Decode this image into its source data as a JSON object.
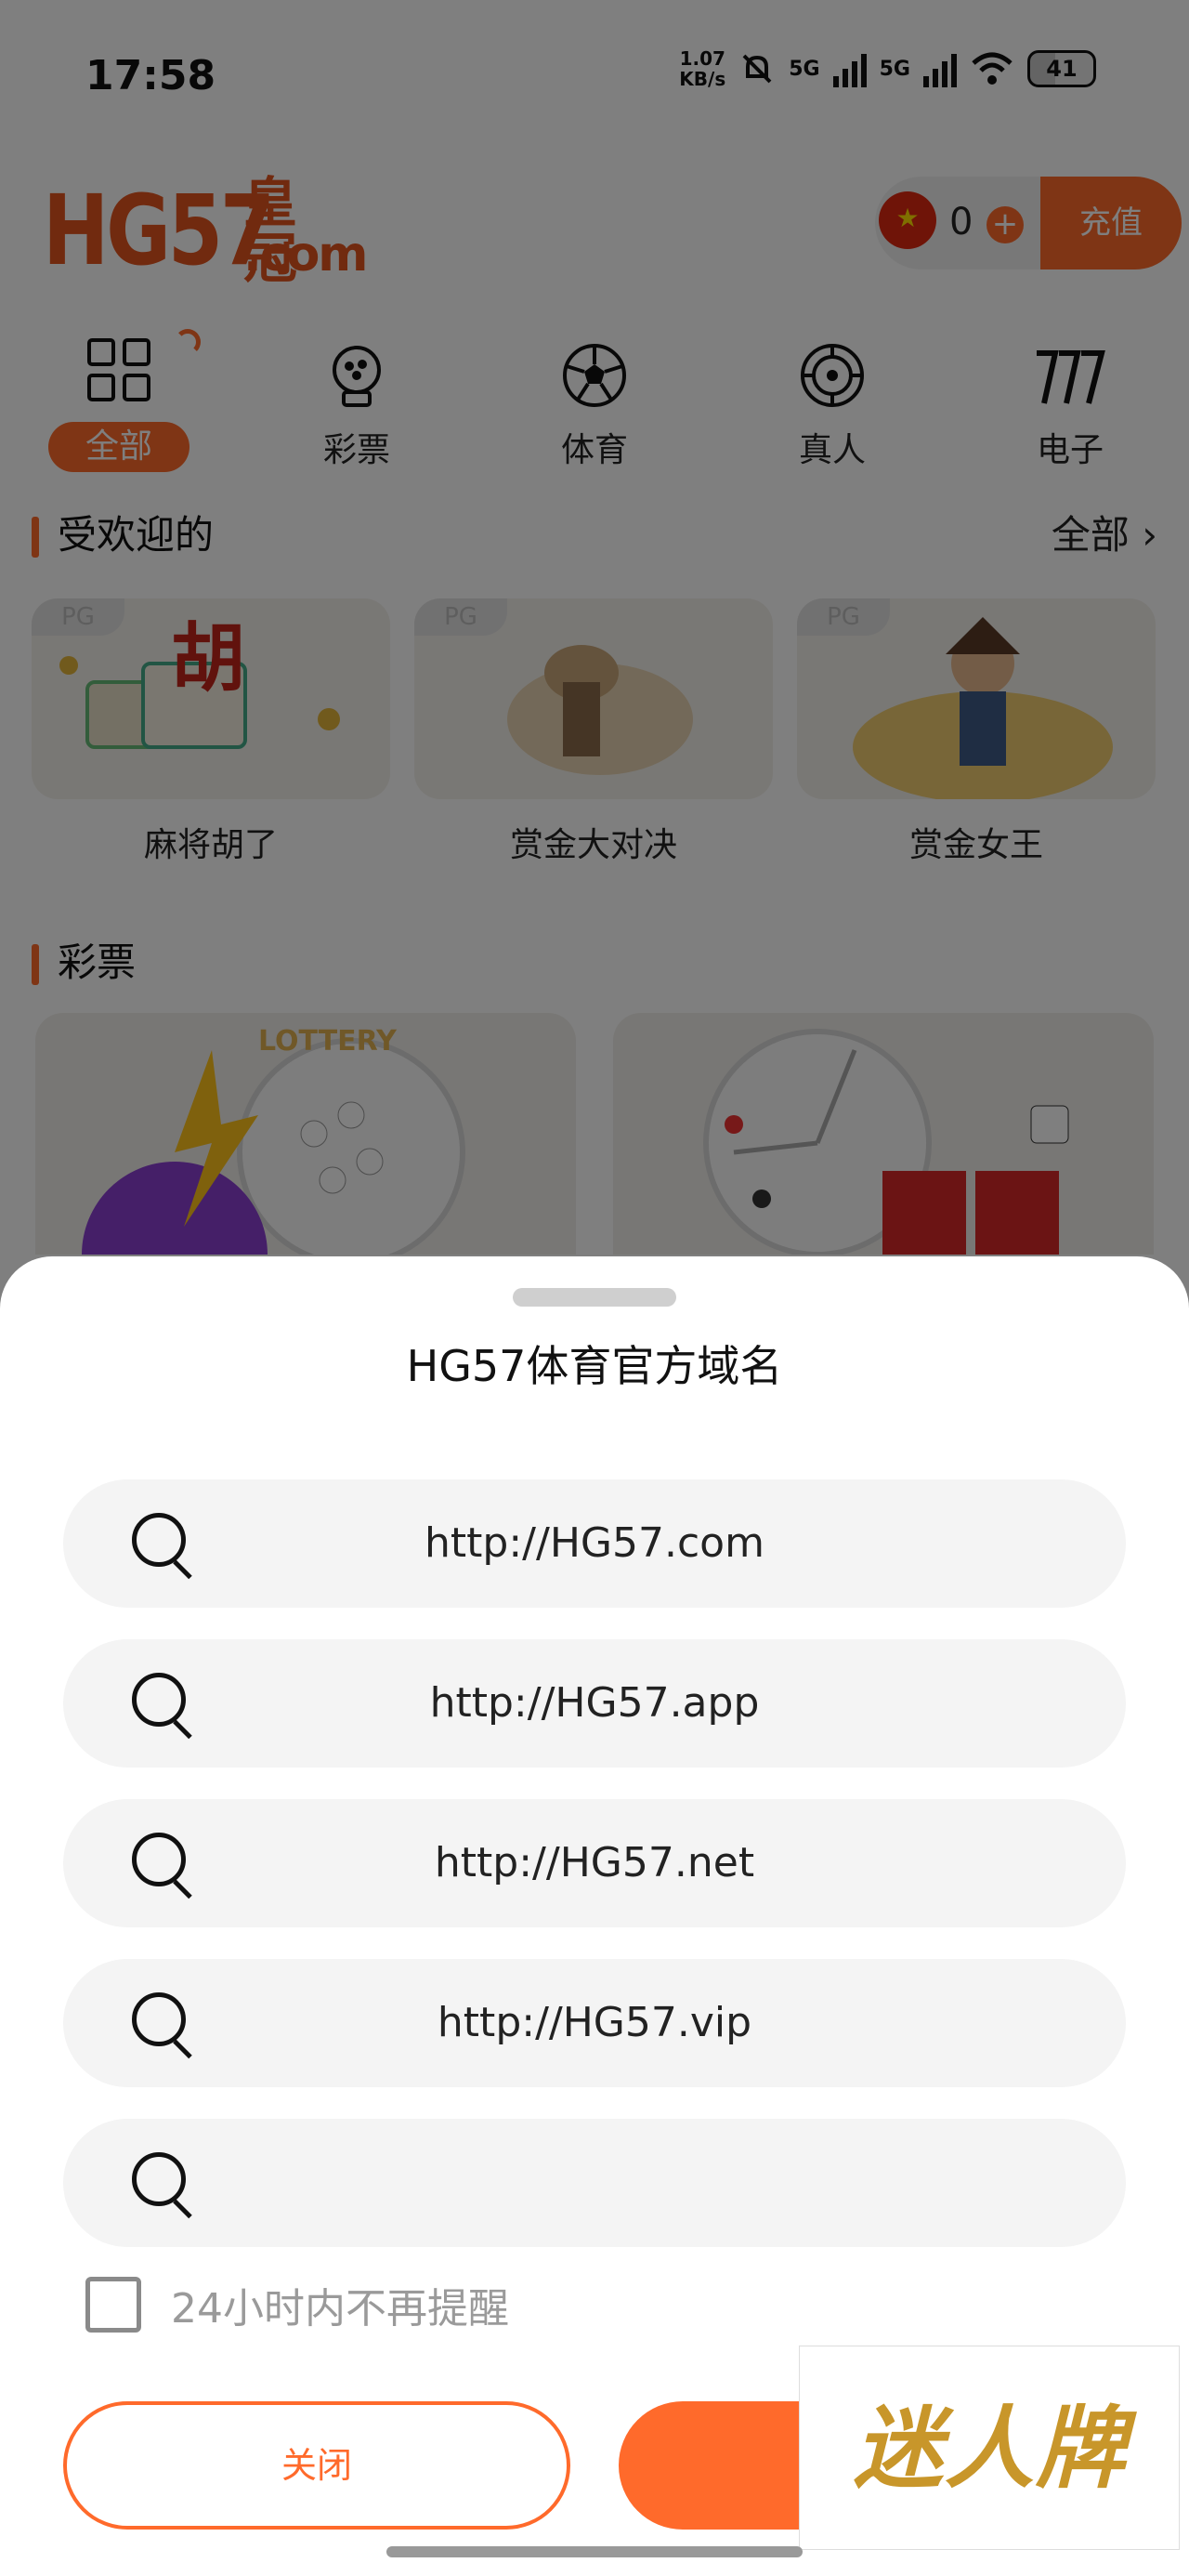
{
  "status_bar": {
    "time": "17:58",
    "net_speed_value": "1.07",
    "net_speed_unit": "KB/s",
    "sig1": "5G",
    "sig2": "5G",
    "battery": "41"
  },
  "header": {
    "logo_main": "HG57",
    "logo_cn": "皇冠",
    "logo_com": ".com",
    "balance": "0",
    "recharge_label": "充值"
  },
  "categories": [
    {
      "label": "全部",
      "icon": "grid-icon",
      "active": true
    },
    {
      "label": "彩票",
      "icon": "lottery-machine-icon"
    },
    {
      "label": "体育",
      "icon": "soccer-ball-icon"
    },
    {
      "label": "真人",
      "icon": "roulette-icon"
    },
    {
      "label": "电子",
      "icon": "slot-777-icon"
    }
  ],
  "popular": {
    "title": "受欢迎的",
    "more": "全部",
    "games": [
      {
        "name": "麻将胡了",
        "tag": "PG"
      },
      {
        "name": "赏金大对决",
        "tag": "PG"
      },
      {
        "name": "赏金女王",
        "tag": "PG"
      }
    ]
  },
  "lottery_section": {
    "title": "彩票",
    "card_label": "LOTTERY"
  },
  "dialog": {
    "title": "HG57体育官方域名",
    "domains": [
      "http://HG57.com",
      "http://HG57.app",
      "http://HG57.net",
      "http://HG57.vip",
      ""
    ],
    "remind_label": "24小时内不再提醒",
    "close_label": "关闭"
  },
  "watermark": "迷人牌",
  "colors": {
    "accent": "#ff6a2b",
    "logo": "#e3541f"
  }
}
